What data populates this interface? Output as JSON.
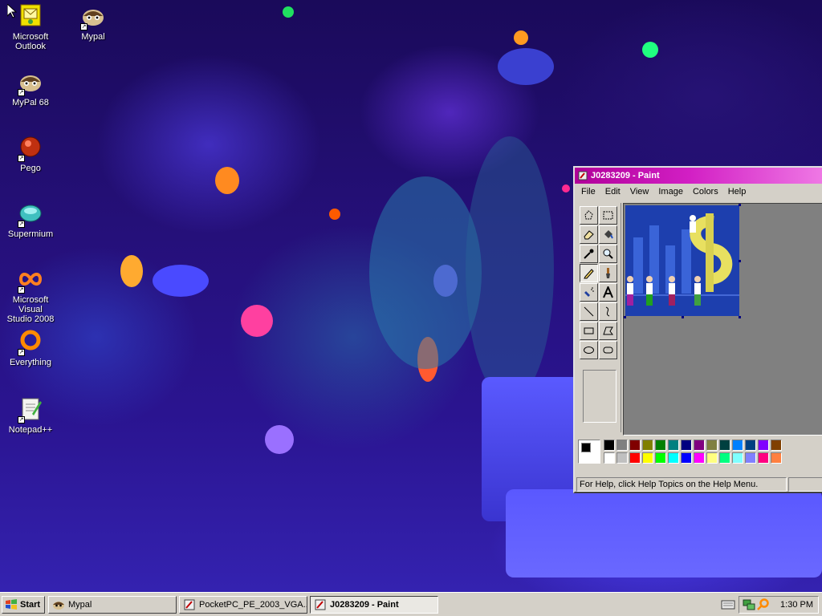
{
  "desktop": {
    "icons": [
      {
        "label": "Microsoft\nOutlook"
      },
      {
        "label": "Mypal"
      },
      {
        "label": "MyPal 68"
      },
      {
        "label": "Pego"
      },
      {
        "label": "Supermium"
      },
      {
        "label": "Microsoft Visual\nStudio 2008"
      },
      {
        "label": "Everything"
      },
      {
        "label": "Notepad++"
      }
    ]
  },
  "paint": {
    "title": "J0283209 - Paint",
    "menu": [
      "File",
      "Edit",
      "View",
      "Image",
      "Colors",
      "Help"
    ],
    "tools": [
      "free-form-select",
      "select",
      "eraser",
      "fill-with-color",
      "pick-color",
      "magnifier",
      "pencil",
      "brush",
      "airbrush",
      "text",
      "line",
      "curve",
      "rectangle",
      "polygon",
      "ellipse",
      "rounded-rectangle"
    ],
    "active_tool": "pencil",
    "palette_row1": [
      "#000000",
      "#808080",
      "#800000",
      "#808000",
      "#008000",
      "#008080",
      "#000080",
      "#800080",
      "#808040",
      "#004040",
      "#0080ff",
      "#004080",
      "#8000ff",
      "#804000"
    ],
    "palette_row2": [
      "#ffffff",
      "#c0c0c0",
      "#ff0000",
      "#ffff00",
      "#00ff00",
      "#00ffff",
      "#0000ff",
      "#ff00ff",
      "#ffff80",
      "#00ff80",
      "#80ffff",
      "#8080ff",
      "#ff0080",
      "#ff8040"
    ],
    "status": "For Help, click Help Topics on the Help Menu."
  },
  "taskbar": {
    "start_label": "Start",
    "tasks": [
      {
        "label": "Mypal"
      },
      {
        "label": "PocketPC_PE_2003_VGA..."
      },
      {
        "label": "J0283209 - Paint"
      }
    ],
    "clock": "1:30 PM"
  }
}
